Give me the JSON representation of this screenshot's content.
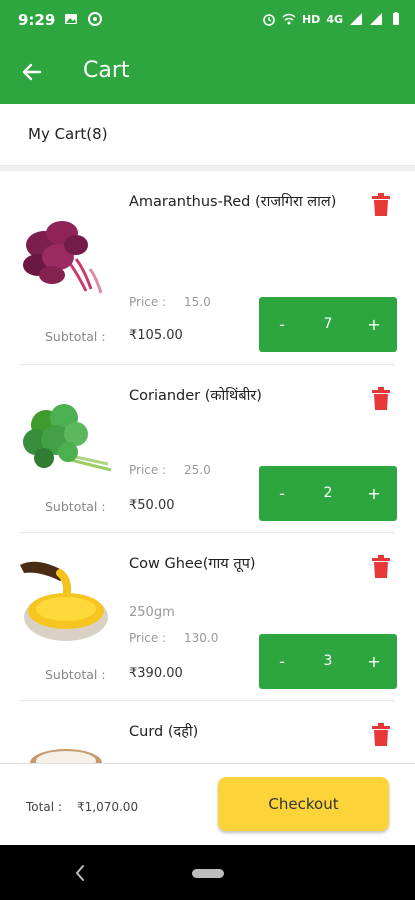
{
  "status_bar": {
    "time": "9:29",
    "network": "HD",
    "signal": "4G",
    "icons": [
      "image-icon",
      "sync-icon",
      "alarm-icon",
      "wifi-calling-icon",
      "signal-icon",
      "battery-icon"
    ]
  },
  "app_bar": {
    "title": "Cart",
    "back_icon": "arrow-left-icon",
    "color": "#2ea63f"
  },
  "cart_header": {
    "label": "My Cart(8)"
  },
  "items": [
    {
      "name": "Amaranthus-Red (राजगिरा लाल)",
      "weight": "",
      "price_label": "Price :",
      "price": "15.0",
      "subtotal_label": "Subtotal :",
      "subtotal": "₹105.00",
      "quantity": "7",
      "minus": "-",
      "plus": "+"
    },
    {
      "name": "Coriander (कोथिंबीर)",
      "weight": "",
      "price_label": "Price :",
      "price": "25.0",
      "subtotal_label": "Subtotal :",
      "subtotal": "₹50.00",
      "quantity": "2",
      "minus": "-",
      "plus": "+"
    },
    {
      "name": "Cow Ghee(गाय तूप)",
      "weight": "250gm",
      "price_label": "Price :",
      "price": "130.0",
      "subtotal_label": "Subtotal :",
      "subtotal": "₹390.00",
      "quantity": "3",
      "minus": "-",
      "plus": "+"
    },
    {
      "name": "Curd (दही)",
      "weight": "",
      "price_label": "",
      "price": "",
      "subtotal_label": "",
      "subtotal": "",
      "quantity": "",
      "minus": "",
      "plus": ""
    }
  ],
  "footer": {
    "total_label": "Total :",
    "total_value": "₹1,070.00",
    "checkout_label": "Checkout",
    "checkout_color": "#fcd43a"
  },
  "colors": {
    "primary": "#2ea63f",
    "delete": "#e53935",
    "accent": "#fcd43a"
  }
}
